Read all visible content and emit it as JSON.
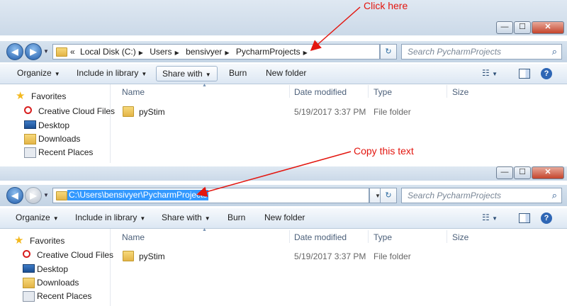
{
  "annotations": {
    "click_here": "Click here",
    "copy_text": "Copy this text",
    "color": "#e3160f"
  },
  "window_top": {
    "caption_buttons": {
      "minimize": "—",
      "maximize": "☐",
      "close": "✕"
    },
    "address_parts": [
      "«",
      "Local Disk (C:)",
      "Users",
      "bensivyer",
      "PycharmProjects"
    ],
    "refresh_symbol": "↻",
    "search_placeholder": "Search PycharmProjects",
    "toolbar": [
      "Organize",
      "Include in library",
      "Share with",
      "Burn",
      "New folder"
    ],
    "columns": [
      "Name",
      "Date modified",
      "Type",
      "Size"
    ],
    "files": [
      {
        "name": "pyStim",
        "date": "5/19/2017 3:37 PM",
        "type": "File folder"
      }
    ],
    "sidebar": {
      "header": "Favorites",
      "items": [
        "Creative Cloud Files",
        "Desktop",
        "Downloads",
        "Recent Places"
      ]
    }
  },
  "window_bottom": {
    "caption_buttons": {
      "minimize": "—",
      "maximize": "☐",
      "close": "✕"
    },
    "address_path": "C:\\Users\\bensivyer\\PycharmProjects",
    "refresh_symbol": "↻",
    "search_placeholder": "Search PycharmProjects",
    "toolbar": [
      "Organize",
      "Include in library",
      "Share with",
      "Burn",
      "New folder"
    ],
    "columns": [
      "Name",
      "Date modified",
      "Type",
      "Size"
    ],
    "files": [
      {
        "name": "pyStim",
        "date": "5/19/2017 3:37 PM",
        "type": "File folder"
      }
    ],
    "sidebar": {
      "header": "Favorites",
      "items": [
        "Creative Cloud Files",
        "Desktop",
        "Downloads",
        "Recent Places"
      ]
    }
  }
}
